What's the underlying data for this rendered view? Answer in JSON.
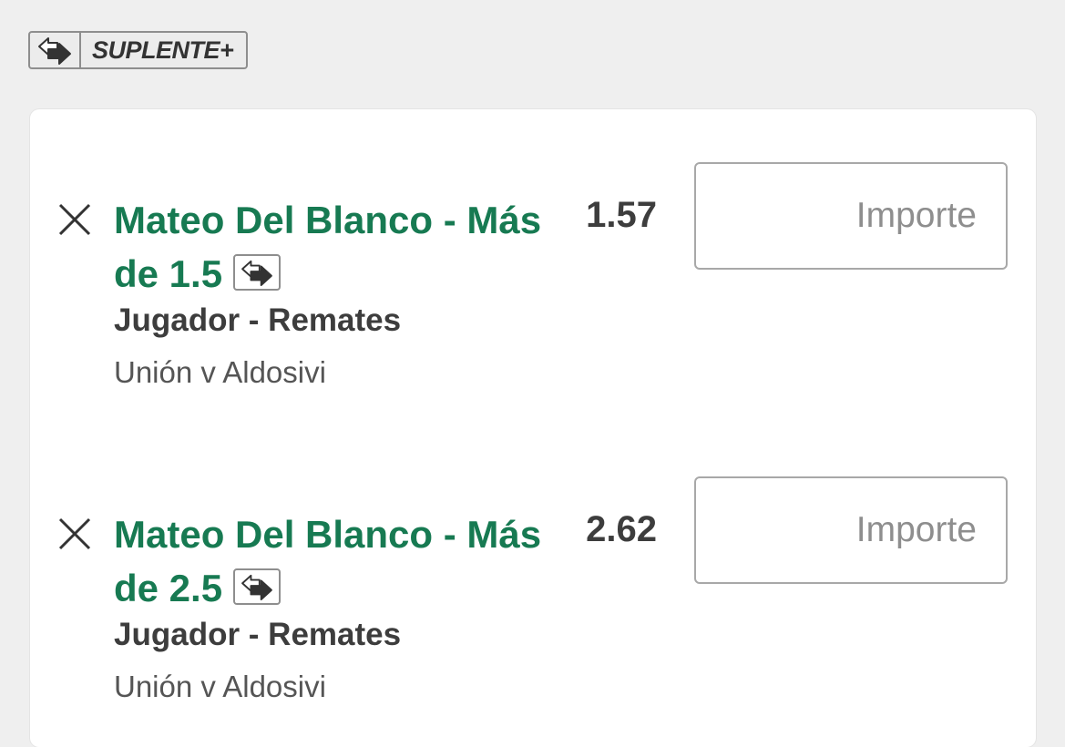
{
  "badge": {
    "label": "SUPLENTE+",
    "icon": "substitute-arrows-icon"
  },
  "bets": [
    {
      "selection": "Mateo Del Blanco - Más de 1.5",
      "market": "Jugador - Remates",
      "event": "Unión v Aldosivi",
      "odds": "1.57",
      "stake_placeholder": "Importe",
      "stake_value": ""
    },
    {
      "selection": "Mateo Del Blanco - Más de 2.5",
      "market": "Jugador - Remates",
      "event": "Unión v Aldosivi",
      "odds": "2.62",
      "stake_placeholder": "Importe",
      "stake_value": ""
    }
  ],
  "colors": {
    "selection_green": "#177a52",
    "background": "#efefef",
    "card": "#ffffff",
    "text_dark": "#3d3d3d"
  }
}
